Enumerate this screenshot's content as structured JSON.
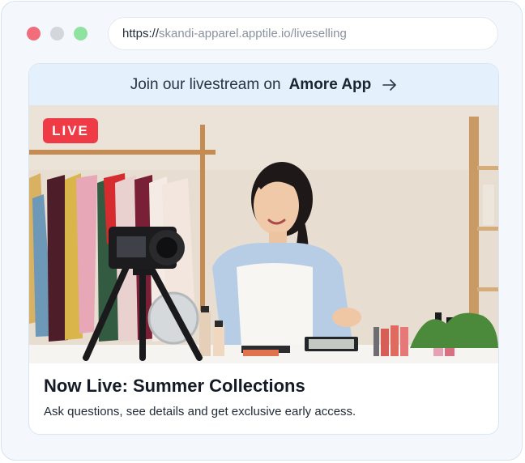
{
  "browser": {
    "url_scheme": "https://",
    "url_host": "skandi-apparel.apptile.io/liveselling",
    "buttons": [
      "close",
      "minimize",
      "maximize"
    ]
  },
  "banner": {
    "text": "Join our livestream on",
    "app_name": "Amore App",
    "icon": "arrow-right-icon"
  },
  "stream": {
    "live_label": "LIVE",
    "image": "woman-presenting-cosmetics-to-camera-in-front-of-clothing-rack"
  },
  "caption": {
    "title": "Now Live: Summer Collections",
    "subtitle": "Ask questions, see details and get exclusive early access."
  },
  "colors": {
    "live_badge": "#ef3b45",
    "banner_bg": "#e4f0fb",
    "window_bg": "#f4f8fc"
  }
}
